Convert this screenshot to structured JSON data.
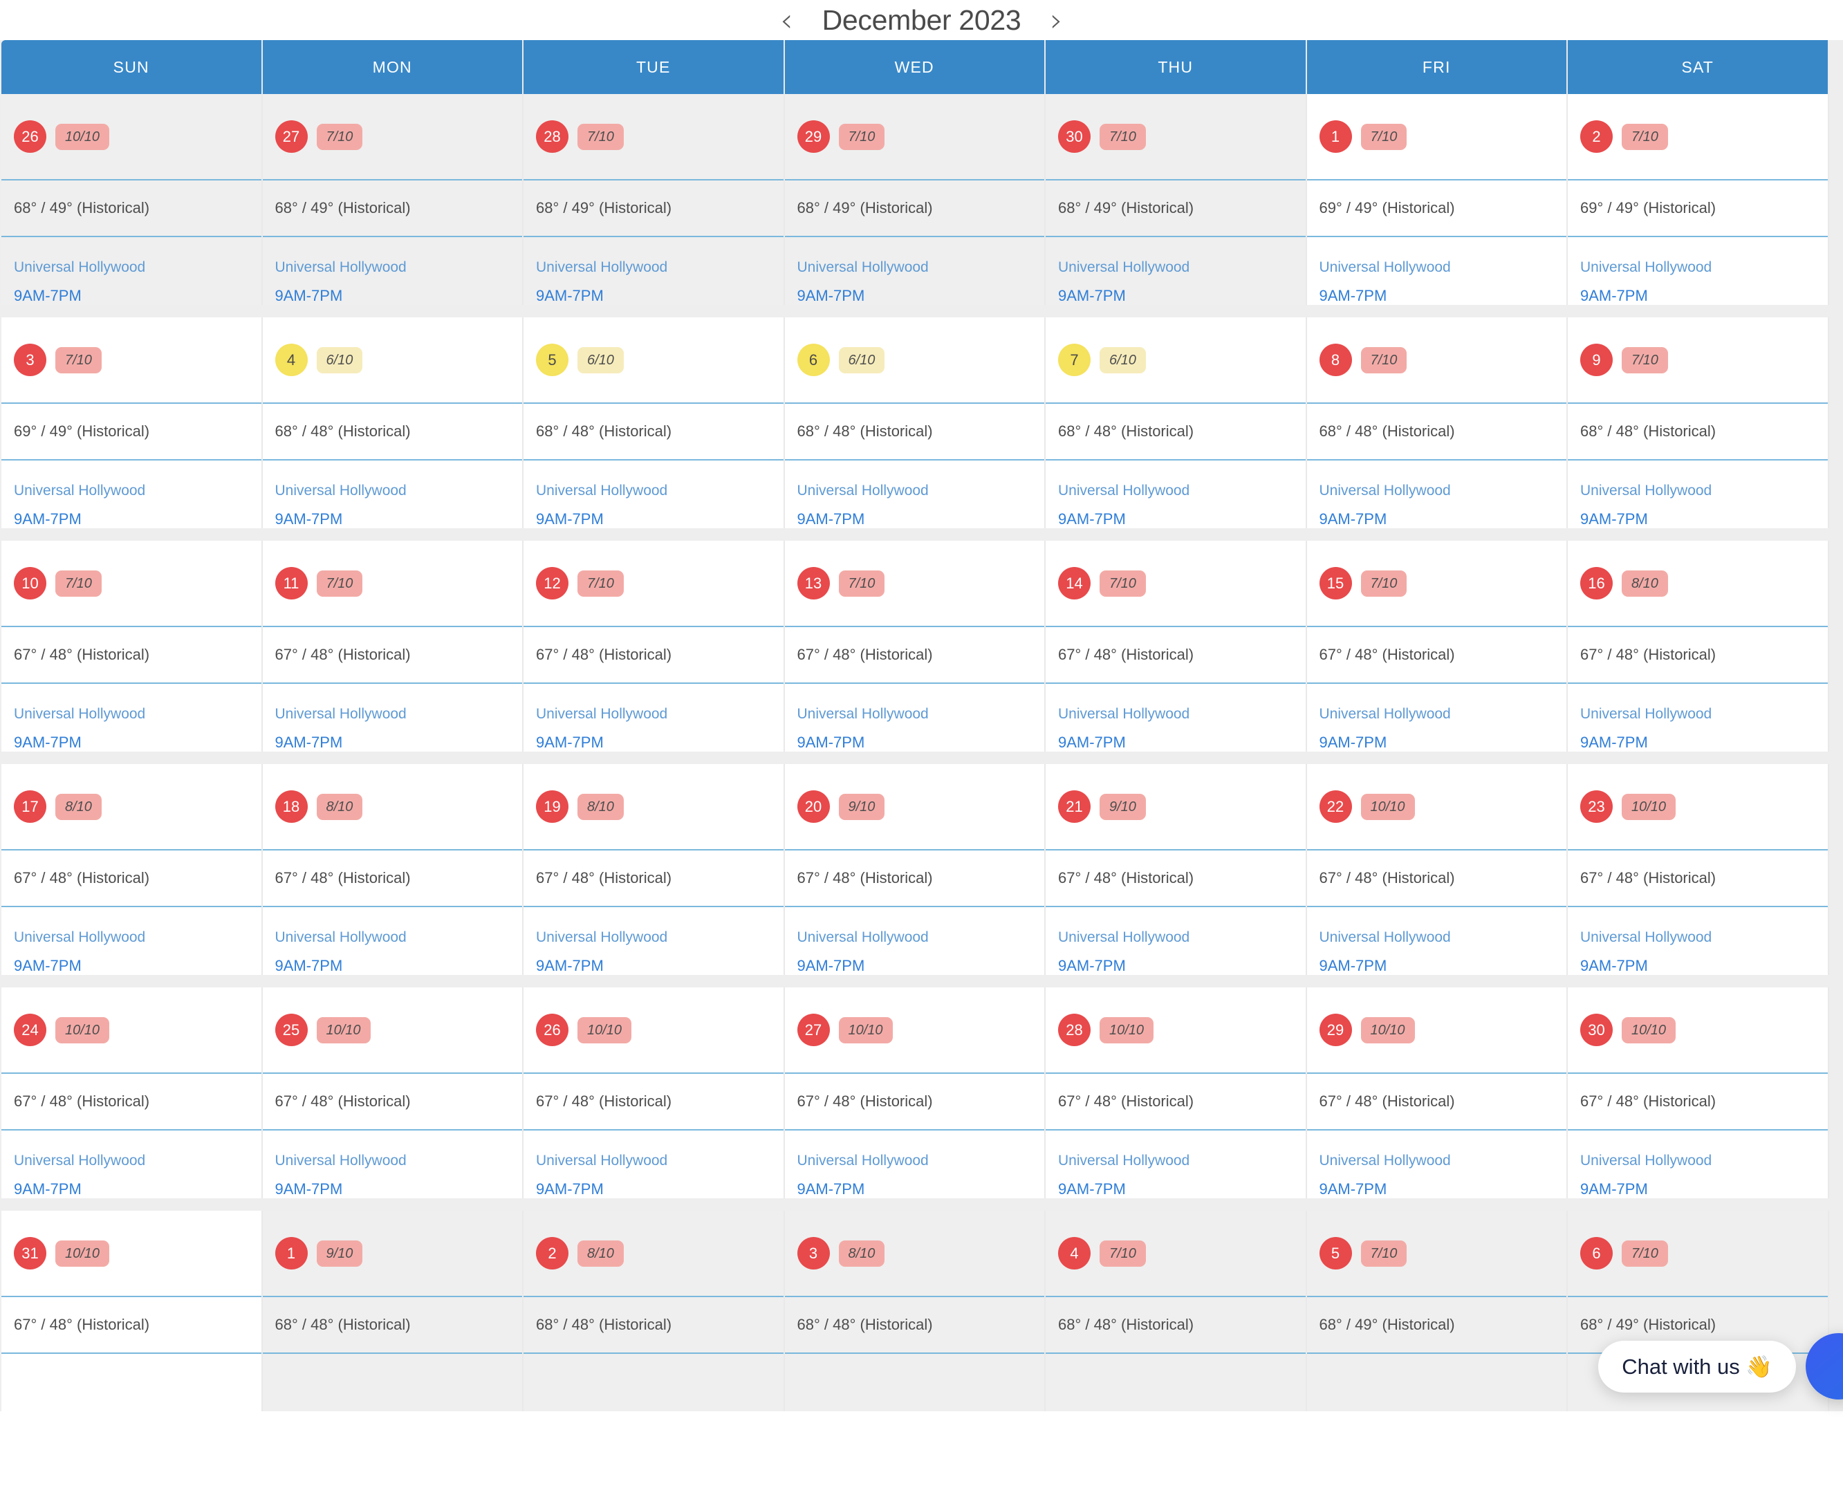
{
  "header": {
    "prev_label": "‹",
    "next_label": "›",
    "title": "December 2023"
  },
  "weekdays": [
    "SUN",
    "MON",
    "TUE",
    "WED",
    "THU",
    "FRI",
    "SAT"
  ],
  "chat": {
    "bubble_label": "Chat with us 👋"
  },
  "colors": {
    "header_blue": "#3888c8",
    "badge_red": "#e8494b",
    "badge_yellow": "#f5e25d",
    "pill_red": "#f3aaa6",
    "pill_yellow": "#f6ecbb",
    "divider_blue": "#7ab8dd",
    "link_blue": "#5e9ad4",
    "time_blue": "#2f7ed8"
  },
  "event_defaults": {
    "name": "Universal Hollywood",
    "time": "9AM-7PM"
  },
  "weeks": [
    [
      {
        "date": "26",
        "rating": "10/10",
        "badge": "red",
        "weather": "68° / 49° (Historical)",
        "event": "Universal Hollywood",
        "time": "9AM-7PM",
        "other_month": true
      },
      {
        "date": "27",
        "rating": "7/10",
        "badge": "red",
        "weather": "68° / 49° (Historical)",
        "event": "Universal Hollywood",
        "time": "9AM-7PM",
        "other_month": true
      },
      {
        "date": "28",
        "rating": "7/10",
        "badge": "red",
        "weather": "68° / 49° (Historical)",
        "event": "Universal Hollywood",
        "time": "9AM-7PM",
        "other_month": true
      },
      {
        "date": "29",
        "rating": "7/10",
        "badge": "red",
        "weather": "68° / 49° (Historical)",
        "event": "Universal Hollywood",
        "time": "9AM-7PM",
        "other_month": true
      },
      {
        "date": "30",
        "rating": "7/10",
        "badge": "red",
        "weather": "68° / 49° (Historical)",
        "event": "Universal Hollywood",
        "time": "9AM-7PM",
        "other_month": true
      },
      {
        "date": "1",
        "rating": "7/10",
        "badge": "red",
        "weather": "69° / 49° (Historical)",
        "event": "Universal Hollywood",
        "time": "9AM-7PM",
        "other_month": false
      },
      {
        "date": "2",
        "rating": "7/10",
        "badge": "red",
        "weather": "69° / 49° (Historical)",
        "event": "Universal Hollywood",
        "time": "9AM-7PM",
        "other_month": false
      }
    ],
    [
      {
        "date": "3",
        "rating": "7/10",
        "badge": "red",
        "weather": "69° / 49° (Historical)",
        "event": "Universal Hollywood",
        "time": "9AM-7PM",
        "other_month": false
      },
      {
        "date": "4",
        "rating": "6/10",
        "badge": "yellow",
        "weather": "68° / 48° (Historical)",
        "event": "Universal Hollywood",
        "time": "9AM-7PM",
        "other_month": false
      },
      {
        "date": "5",
        "rating": "6/10",
        "badge": "yellow",
        "weather": "68° / 48° (Historical)",
        "event": "Universal Hollywood",
        "time": "9AM-7PM",
        "other_month": false
      },
      {
        "date": "6",
        "rating": "6/10",
        "badge": "yellow",
        "weather": "68° / 48° (Historical)",
        "event": "Universal Hollywood",
        "time": "9AM-7PM",
        "other_month": false
      },
      {
        "date": "7",
        "rating": "6/10",
        "badge": "yellow",
        "weather": "68° / 48° (Historical)",
        "event": "Universal Hollywood",
        "time": "9AM-7PM",
        "other_month": false
      },
      {
        "date": "8",
        "rating": "7/10",
        "badge": "red",
        "weather": "68° / 48° (Historical)",
        "event": "Universal Hollywood",
        "time": "9AM-7PM",
        "other_month": false
      },
      {
        "date": "9",
        "rating": "7/10",
        "badge": "red",
        "weather": "68° / 48° (Historical)",
        "event": "Universal Hollywood",
        "time": "9AM-7PM",
        "other_month": false
      }
    ],
    [
      {
        "date": "10",
        "rating": "7/10",
        "badge": "red",
        "weather": "67° / 48° (Historical)",
        "event": "Universal Hollywood",
        "time": "9AM-7PM",
        "other_month": false
      },
      {
        "date": "11",
        "rating": "7/10",
        "badge": "red",
        "weather": "67° / 48° (Historical)",
        "event": "Universal Hollywood",
        "time": "9AM-7PM",
        "other_month": false
      },
      {
        "date": "12",
        "rating": "7/10",
        "badge": "red",
        "weather": "67° / 48° (Historical)",
        "event": "Universal Hollywood",
        "time": "9AM-7PM",
        "other_month": false
      },
      {
        "date": "13",
        "rating": "7/10",
        "badge": "red",
        "weather": "67° / 48° (Historical)",
        "event": "Universal Hollywood",
        "time": "9AM-7PM",
        "other_month": false
      },
      {
        "date": "14",
        "rating": "7/10",
        "badge": "red",
        "weather": "67° / 48° (Historical)",
        "event": "Universal Hollywood",
        "time": "9AM-7PM",
        "other_month": false
      },
      {
        "date": "15",
        "rating": "7/10",
        "badge": "red",
        "weather": "67° / 48° (Historical)",
        "event": "Universal Hollywood",
        "time": "9AM-7PM",
        "other_month": false
      },
      {
        "date": "16",
        "rating": "8/10",
        "badge": "red",
        "weather": "67° / 48° (Historical)",
        "event": "Universal Hollywood",
        "time": "9AM-7PM",
        "other_month": false
      }
    ],
    [
      {
        "date": "17",
        "rating": "8/10",
        "badge": "red",
        "weather": "67° / 48° (Historical)",
        "event": "Universal Hollywood",
        "time": "9AM-7PM",
        "other_month": false
      },
      {
        "date": "18",
        "rating": "8/10",
        "badge": "red",
        "weather": "67° / 48° (Historical)",
        "event": "Universal Hollywood",
        "time": "9AM-7PM",
        "other_month": false
      },
      {
        "date": "19",
        "rating": "8/10",
        "badge": "red",
        "weather": "67° / 48° (Historical)",
        "event": "Universal Hollywood",
        "time": "9AM-7PM",
        "other_month": false
      },
      {
        "date": "20",
        "rating": "9/10",
        "badge": "red",
        "weather": "67° / 48° (Historical)",
        "event": "Universal Hollywood",
        "time": "9AM-7PM",
        "other_month": false
      },
      {
        "date": "21",
        "rating": "9/10",
        "badge": "red",
        "weather": "67° / 48° (Historical)",
        "event": "Universal Hollywood",
        "time": "9AM-7PM",
        "other_month": false
      },
      {
        "date": "22",
        "rating": "10/10",
        "badge": "red",
        "weather": "67° / 48° (Historical)",
        "event": "Universal Hollywood",
        "time": "9AM-7PM",
        "other_month": false
      },
      {
        "date": "23",
        "rating": "10/10",
        "badge": "red",
        "weather": "67° / 48° (Historical)",
        "event": "Universal Hollywood",
        "time": "9AM-7PM",
        "other_month": false
      }
    ],
    [
      {
        "date": "24",
        "rating": "10/10",
        "badge": "red",
        "weather": "67° / 48° (Historical)",
        "event": "Universal Hollywood",
        "time": "9AM-7PM",
        "other_month": false
      },
      {
        "date": "25",
        "rating": "10/10",
        "badge": "red",
        "weather": "67° / 48° (Historical)",
        "event": "Universal Hollywood",
        "time": "9AM-7PM",
        "other_month": false
      },
      {
        "date": "26",
        "rating": "10/10",
        "badge": "red",
        "weather": "67° / 48° (Historical)",
        "event": "Universal Hollywood",
        "time": "9AM-7PM",
        "other_month": false
      },
      {
        "date": "27",
        "rating": "10/10",
        "badge": "red",
        "weather": "67° / 48° (Historical)",
        "event": "Universal Hollywood",
        "time": "9AM-7PM",
        "other_month": false
      },
      {
        "date": "28",
        "rating": "10/10",
        "badge": "red",
        "weather": "67° / 48° (Historical)",
        "event": "Universal Hollywood",
        "time": "9AM-7PM",
        "other_month": false
      },
      {
        "date": "29",
        "rating": "10/10",
        "badge": "red",
        "weather": "67° / 48° (Historical)",
        "event": "Universal Hollywood",
        "time": "9AM-7PM",
        "other_month": false
      },
      {
        "date": "30",
        "rating": "10/10",
        "badge": "red",
        "weather": "67° / 48° (Historical)",
        "event": "Universal Hollywood",
        "time": "9AM-7PM",
        "other_month": false
      }
    ],
    [
      {
        "date": "31",
        "rating": "10/10",
        "badge": "red",
        "weather": "67° / 48° (Historical)",
        "event": "",
        "time": "",
        "other_month": false
      },
      {
        "date": "1",
        "rating": "9/10",
        "badge": "red",
        "weather": "68° / 48° (Historical)",
        "event": "",
        "time": "",
        "other_month": true
      },
      {
        "date": "2",
        "rating": "8/10",
        "badge": "red",
        "weather": "68° / 48° (Historical)",
        "event": "",
        "time": "",
        "other_month": true
      },
      {
        "date": "3",
        "rating": "8/10",
        "badge": "red",
        "weather": "68° / 48° (Historical)",
        "event": "",
        "time": "",
        "other_month": true
      },
      {
        "date": "4",
        "rating": "7/10",
        "badge": "red",
        "weather": "68° / 48° (Historical)",
        "event": "",
        "time": "",
        "other_month": true
      },
      {
        "date": "5",
        "rating": "7/10",
        "badge": "red",
        "weather": "68° / 49° (Historical)",
        "event": "",
        "time": "",
        "other_month": true
      },
      {
        "date": "6",
        "rating": "7/10",
        "badge": "red",
        "weather": "68° / 49° (Historical)",
        "event": "",
        "time": "",
        "other_month": true
      }
    ]
  ]
}
